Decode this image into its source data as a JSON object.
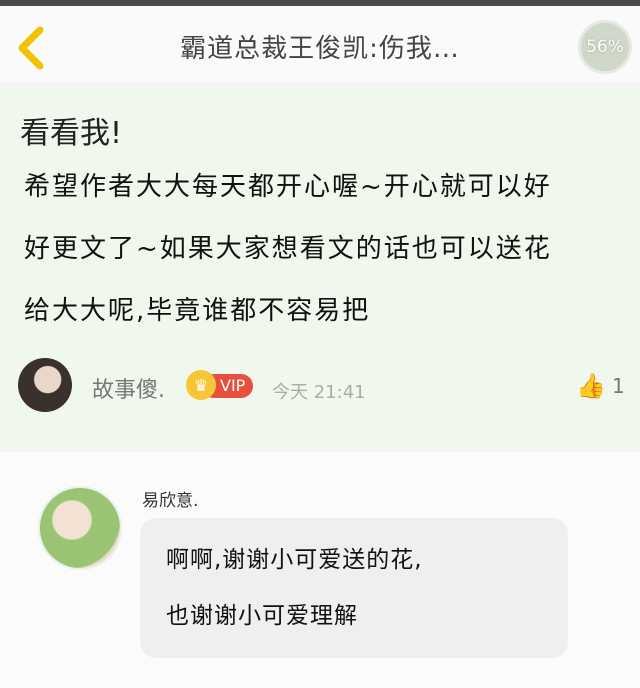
{
  "header": {
    "back_icon": "chevron-left-icon",
    "title": "霸道总裁王俊凯:伤我…",
    "progress": "56%",
    "accent": "#f2c200"
  },
  "post": {
    "title": "看看我!",
    "body_lines": [
      "希望作者大大每天都开心喔~开心就可以好",
      "好更文了~如果大家想看文的话也可以送花",
      "给大大呢,毕竟谁都不容易把"
    ],
    "author": {
      "name": "故事傻.",
      "badge": "VIP",
      "time": "今天 21:41"
    },
    "likes": "1"
  },
  "reply": {
    "name": "易欣意.",
    "lines": [
      "啊啊,谢谢小可爱送的花,",
      "也谢谢小可爱理解"
    ]
  }
}
